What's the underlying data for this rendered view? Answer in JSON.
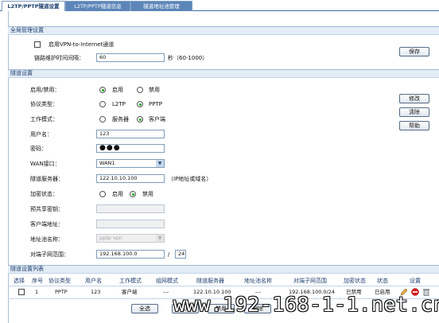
{
  "tabs": [
    {
      "label": "L2TP/PPTP隧道设置"
    },
    {
      "label": "L2TP/PPTP隧道信息"
    },
    {
      "label": "隧道地址池管理"
    }
  ],
  "global": {
    "section_title": "全局管理设置",
    "enable_vpn_label": "启用VPN-to-Internet通道",
    "keepalive_label": "链路维护时间间隔：",
    "keepalive_value": "60",
    "keepalive_unit": "秒（60-1000）",
    "save_label": "保存"
  },
  "tunnel": {
    "section_title": "隧道设置",
    "enable_label": "启用/禁用：",
    "enable_on": "启用",
    "enable_off": "禁用",
    "protocol_label": "协议类型：",
    "protocol_l2tp": "L2TP",
    "protocol_pptp": "PPTP",
    "mode_label": "工作模式：",
    "mode_server": "服务器",
    "mode_client": "客户端",
    "username_label": "用户名：",
    "username_value": "123",
    "password_label": "密码：",
    "password_value": "●●●",
    "wan_label": "WAN接口：",
    "wan_value": "WAN1",
    "server_label": "隧道服务器：",
    "server_value": "122.10.10.100",
    "server_hint": "（IP地址或域名）",
    "encrypt_label": "加密状态：",
    "encrypt_on": "启用",
    "encrypt_off": "禁用",
    "psk_label": "预共享密钥：",
    "client_addr_label": "客户端地址：",
    "pool_label": "地址池名称：",
    "pool_value": "pptp vpn",
    "peer_range_label": "对端子网范围：",
    "peer_range_ip": "192.168.100.0",
    "peer_range_sep": "/",
    "peer_range_mask": "24",
    "buttons": {
      "modify": "修改",
      "clear": "清除",
      "help": "帮助"
    }
  },
  "list": {
    "section_title": "隧道设置列表",
    "headers": [
      "选择",
      "序号",
      "协议类型",
      "用户名",
      "工作模式",
      "组网模式",
      "隧道服务器",
      "地址池名称",
      "对端子网范围",
      "加密状态",
      "状态",
      "设置"
    ],
    "rows": [
      {
        "index": "1",
        "protocol": "PPTP",
        "user": "123",
        "mode": "客户端",
        "network": "---",
        "server": "122.10.10.100",
        "pool": "---",
        "peer": "192.168.100.0/24",
        "encrypt": "已禁用",
        "status": "已启用"
      }
    ],
    "buttons": {
      "select_all": "全选",
      "enable": "启用",
      "disable": "禁用",
      "delete": "删除"
    }
  },
  "watermark": "www.192-168-1-1.net.cn",
  "colors": {
    "tab_bg": "#5c85b8",
    "section_bg": "#e3ecf6",
    "radio_dot": "#13a313"
  },
  "icons": [
    "edit-icon",
    "delete-icon",
    "trash-icon"
  ]
}
